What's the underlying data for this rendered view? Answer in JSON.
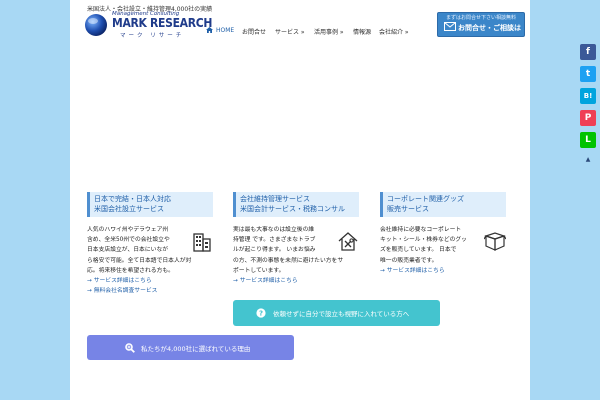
{
  "header": {
    "tagline": "米国法人・会社設立・維持管理4,000社の実績",
    "logo": {
      "sub": "Management Consulting",
      "main": "MARK RESEARCH",
      "kana": "マーク リサーチ"
    },
    "cta": {
      "top": "まずはお問合せ下さい相談無料",
      "label": "お問合せ・ご相談は",
      "icon": "envelope-icon"
    }
  },
  "nav": {
    "items": [
      "HOME",
      "お問合せ",
      "サービス »",
      "活用事例 »",
      "情報源",
      "会社紹介 »"
    ]
  },
  "cards": [
    {
      "title_lines": [
        "日本で完結・日本人対応",
        "米国会社設立サービス"
      ],
      "text_lines": [
        "人気のハワイ州やデラウェア州",
        "含め、全米50州での会社設立や",
        "日本支店設立が、日本にいなが",
        "ら格安で可能。全て日本語で日本人が対",
        "応。将来移住を希望される方も。"
      ],
      "links": [
        "→ サービス詳細はこちら",
        "→ 無料会社名調査サービス"
      ],
      "icon": "building-icon"
    },
    {
      "title_lines": [
        "会社維持管理サービス",
        "米国会計サービス・税務コンサル"
      ],
      "text_lines": [
        "実は最も大事なのは設立後の維",
        "持管理 です。さまざまなトラブ",
        "ルが起こり得ます。 いまお悩み",
        "の方、不測の事態を未然に避けたい方をサ",
        "ポートしています。"
      ],
      "links": [
        "→ サービス詳細はこちら"
      ],
      "icon": "house-tools-icon"
    },
    {
      "title_lines": [
        "コーポレート関連グッズ",
        "販売サービス"
      ],
      "text_lines": [
        "会社維持に必要なコーポレート",
        "キット・シール・株券などのグッ",
        "ズを販売しています。 日本で",
        "唯一の販売業者です。"
      ],
      "links": [
        "→ サービス詳細はこちら"
      ],
      "icon": "box-icon"
    }
  ],
  "buttons": {
    "teal": {
      "label": "依頼せずに自分で設立も視野に入れている方へ",
      "icon": "question-circle-icon",
      "color": "#44c4cf"
    },
    "blue": {
      "label": "私たちが4,000社に選ばれている理由",
      "icon": "search-icon",
      "color": "#7784e6"
    }
  },
  "share": {
    "items": [
      {
        "name": "facebook",
        "glyph": "f",
        "color": "#3b5998"
      },
      {
        "name": "twitter",
        "glyph": "t",
        "color": "#1da1f2"
      },
      {
        "name": "hatena",
        "glyph": "B!",
        "color": "#00a4de"
      },
      {
        "name": "pocket",
        "glyph": "P",
        "color": "#ef3f56"
      },
      {
        "name": "line",
        "glyph": "L",
        "color": "#00c300"
      }
    ],
    "more": "▲"
  },
  "colors": {
    "background": "#a8d8f4",
    "accent": "#1f5fa8"
  }
}
